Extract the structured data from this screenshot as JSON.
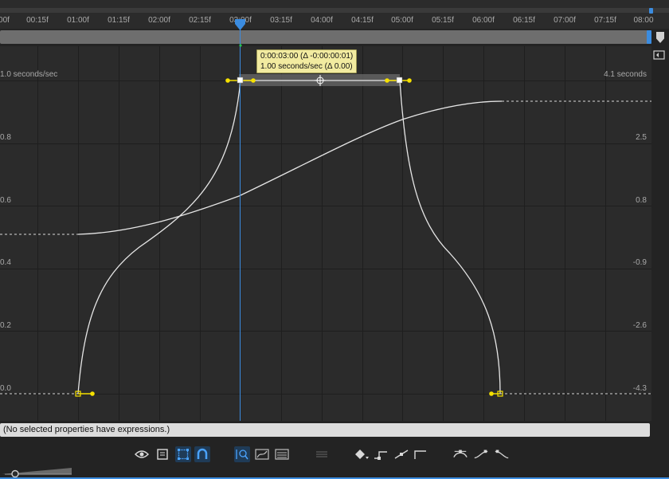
{
  "ruler": {
    "labels": [
      "00f",
      "00:15f",
      "01:00f",
      "01:15f",
      "02:00f",
      "02:15f",
      "03:00f",
      "03:15f",
      "04:00f",
      "04:15f",
      "05:00f",
      "05:15f",
      "06:00f",
      "06:15f",
      "07:00f",
      "07:15f",
      "08:00"
    ],
    "current_time": "03:00f"
  },
  "graph": {
    "left_labels": [
      "1.0 seconds/sec",
      "0.8",
      "0.6",
      "0.4",
      "0.2",
      "0.0"
    ],
    "right_labels": [
      "4.1 seconds",
      "2.5",
      "0.8",
      "-0.9",
      "-2.6",
      "-4.3"
    ],
    "tooltip": {
      "line1": "0:00:03:00 (Δ -0:00:00:01)",
      "line2": "1.00 seconds/sec (Δ 0.00)"
    },
    "colors": {
      "curve": "#e6e6e6",
      "keyframe_handle": "#f5e000",
      "playhead": "#3b8ce0",
      "grid": "#1e1e1e"
    }
  },
  "expression_bar": {
    "text": "(No selected properties have expressions.)"
  },
  "toolbar": {
    "icons": [
      "eye-icon",
      "graph-options-icon",
      "transform-box-icon",
      "snap-icon",
      "fit-selection-icon",
      "fit-all-icon",
      "edit-speed-graph-icon",
      "separate-dimensions-icon",
      "keyframe-interpolation-icon",
      "hold-keyframe-icon",
      "auto-bezier-icon",
      "roving-keyframe-icon",
      "easy-ease-icon",
      "easy-ease-in-icon",
      "easy-ease-out-icon"
    ]
  }
}
